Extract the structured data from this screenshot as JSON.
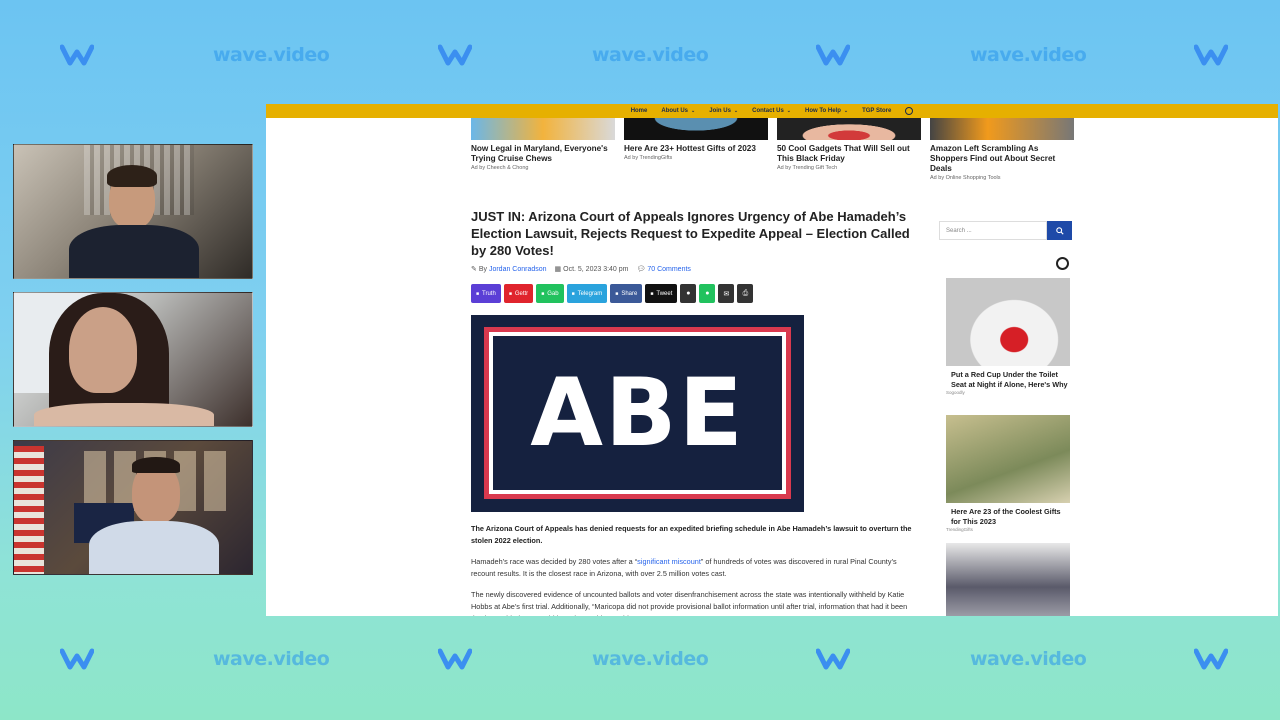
{
  "watermark": {
    "text": "wave.video"
  },
  "nav": {
    "items": [
      {
        "label": "Home",
        "has_menu": false
      },
      {
        "label": "About Us",
        "has_menu": true
      },
      {
        "label": "Join Us",
        "has_menu": true
      },
      {
        "label": "Contact Us",
        "has_menu": true
      },
      {
        "label": "How To Help",
        "has_menu": true
      },
      {
        "label": "TGP Store",
        "has_menu": false
      }
    ],
    "bar_color": "#e6b000"
  },
  "top_ads": [
    {
      "title": "Now Legal in Maryland, Everyone's Trying Cruise Chews",
      "source": "Ad by Cheech & Chong"
    },
    {
      "title": "Here Are 23+ Hottest Gifts of 2023",
      "source": "Ad by TrendingGifts"
    },
    {
      "title": "50 Cool Gadgets That Will Sell out This Black Friday",
      "source": "Ad by Trending Gift Tech"
    },
    {
      "title": "Amazon Left Scrambling As Shoppers Find out About Secret Deals",
      "source": "Ad by Online Shopping Tools"
    }
  ],
  "article": {
    "headline": "JUST IN: Arizona Court of Appeals Ignores Urgency of Abe Hamadeh’s Election Lawsuit, Rejects Request to Expedite Appeal – Election Called by 280 Votes!",
    "by": "By",
    "author": "Jordan Conradson",
    "date": "Oct. 5, 2023 3:40 pm",
    "comments": "70 Comments",
    "hero_text": "ABE",
    "p1": "The Arizona Court of Appeals has denied requests for an expedited briefing schedule in Abe Hamadeh’s lawsuit to overturn the stolen 2022 election.",
    "p2_pre": "Hamadeh’s race was decided by 280 votes after a “",
    "p2_link": "significant miscount",
    "p2_post": "” of hundreds of votes was discovered in rural Pinal County’s recount results. It is the closest race in Arizona, with over 2.5 million votes cast.",
    "p3": "The newly discovered evidence of uncounted ballots and voter disenfranchisement across the state was intentionally withheld by Katie Hobbs at Abe’s first trial. Additionally, “Maricopa did not provide provisional ballot information until after trial, information that had it been timely provided, we would have been able to address"
  },
  "share_buttons": [
    {
      "label": "Truth",
      "color": "#5b3fd6"
    },
    {
      "label": "Gettr",
      "color": "#e0242d"
    },
    {
      "label": "Gab",
      "color": "#21c25e"
    },
    {
      "label": "Telegram",
      "color": "#2aa3dd"
    },
    {
      "label": "Share",
      "color": "#3b5998"
    },
    {
      "label": "Tweet",
      "color": "#111111"
    }
  ],
  "share_icons": [
    "comment-icon",
    "sms-icon",
    "email-icon",
    "print-icon"
  ],
  "sidebar": {
    "search_placeholder": "Search ...",
    "ads": [
      {
        "title": "Put a Red Cup Under the Toilet Seat at Night if Alone, Here's Why",
        "source": "Sogoodly"
      },
      {
        "title": "Here Are 23 of the Coolest Gifts for This 2023",
        "source": "TrendingGifts"
      }
    ]
  }
}
